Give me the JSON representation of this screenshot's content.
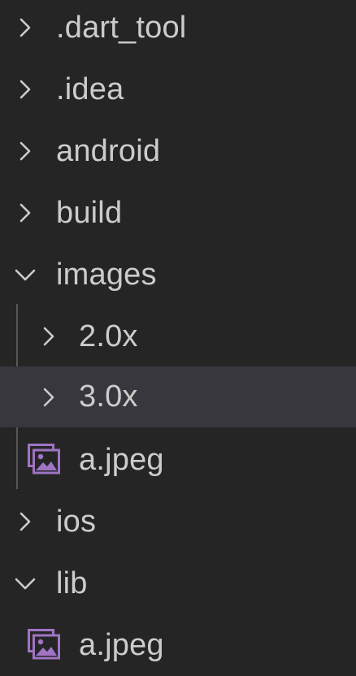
{
  "explorer": {
    "items": [
      {
        "label": ".dart_tool",
        "type": "folder",
        "expanded": false
      },
      {
        "label": ".idea",
        "type": "folder",
        "expanded": false
      },
      {
        "label": "android",
        "type": "folder",
        "expanded": false
      },
      {
        "label": "build",
        "type": "folder",
        "expanded": false
      },
      {
        "label": "images",
        "type": "folder",
        "expanded": true,
        "children": [
          {
            "label": "2.0x",
            "type": "folder",
            "expanded": false
          },
          {
            "label": "3.0x",
            "type": "folder",
            "expanded": false,
            "selected": true
          },
          {
            "label": "a.jpeg",
            "type": "image-file"
          }
        ]
      },
      {
        "label": "ios",
        "type": "folder",
        "expanded": false
      },
      {
        "label": "lib",
        "type": "folder",
        "expanded": true,
        "children": [
          {
            "label": "a.jpeg",
            "type": "image-file"
          }
        ]
      }
    ]
  },
  "colors": {
    "background": "#252526",
    "text": "#cccccc",
    "selected_row": "#37373d",
    "indent_guide": "#585858",
    "image_icon": "#a074c4"
  },
  "icons": {
    "collapsed": "chevron-right-icon",
    "expanded": "chevron-down-icon",
    "image_file": "image-file-icon"
  }
}
